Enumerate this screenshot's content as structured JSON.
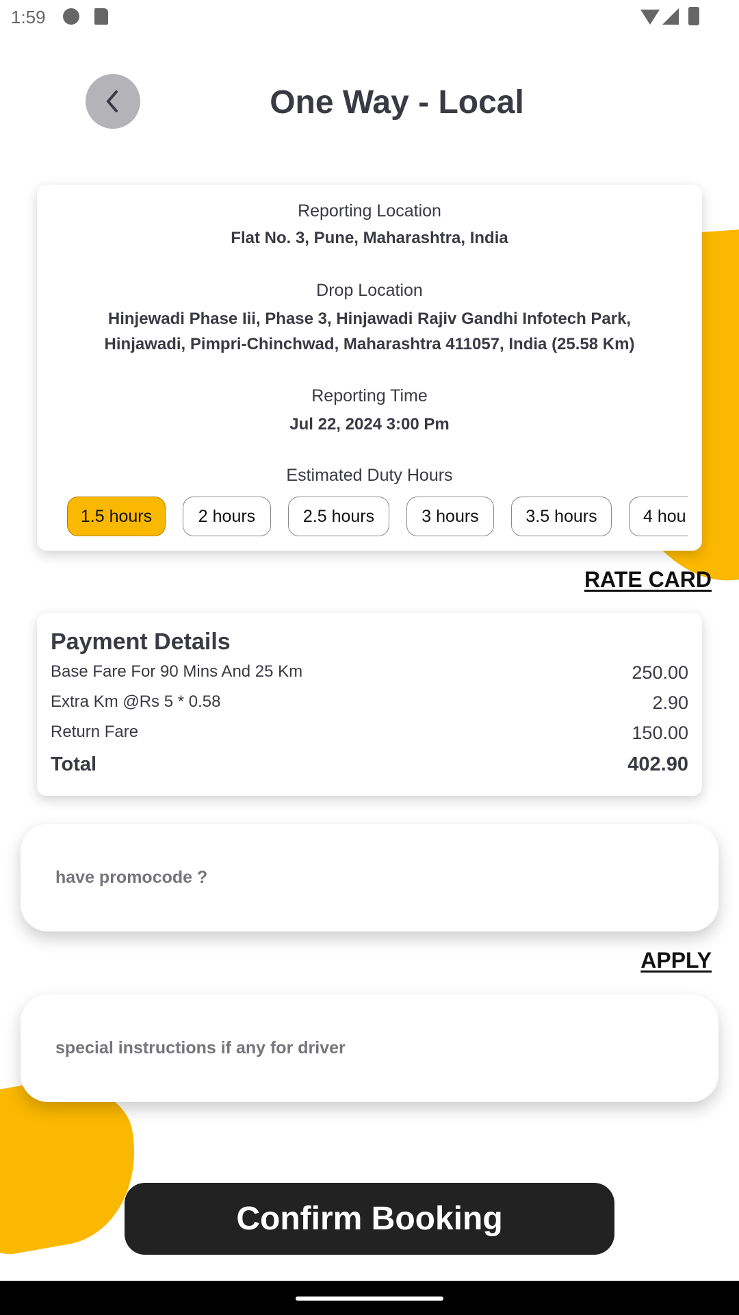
{
  "status_bar": {
    "time": "1:59",
    "icons": [
      "face-icon",
      "sd-card-icon",
      "wifi-icon",
      "signal-icon",
      "battery-icon"
    ]
  },
  "header": {
    "title": "One Way - Local",
    "back_icon": "chevron-left-icon"
  },
  "trip": {
    "reporting_location_label": "Reporting Location",
    "reporting_location": "Flat No. 3, Pune, Maharashtra, India",
    "drop_location_label": "Drop Location",
    "drop_location_line1": "Hinjewadi Phase Iii, Phase 3, Hinjawadi Rajiv Gandhi Infotech Park,",
    "drop_location_line2": "Hinjawadi, Pimpri-Chinchwad, Maharashtra 411057, India (25.58 Km)",
    "reporting_time_label": "Reporting Time",
    "reporting_time": "Jul 22, 2024 3:00 Pm",
    "duty_hours_label": "Estimated Duty Hours",
    "duty_hours": [
      "1.5 hours",
      "2 hours",
      "2.5 hours",
      "3 hours",
      "3.5 hours",
      "4 hou"
    ],
    "selected_duty_hours": "1.5 hours"
  },
  "rate_card_label": "RATE CARD",
  "payment": {
    "title": "Payment Details",
    "rows": [
      {
        "label": "Base Fare For 90 Mins And 25 Km",
        "amount": "250.00"
      },
      {
        "label": "Extra Km @Rs 5 * 0.58",
        "amount": "2.90"
      },
      {
        "label": "Return Fare",
        "amount": "150.00"
      }
    ],
    "total_label": "Total",
    "total": "402.90"
  },
  "promo": {
    "placeholder": "have promocode ?",
    "apply_label": "APPLY"
  },
  "instructions": {
    "placeholder": "special instructions if any for driver"
  },
  "confirm_label": "Confirm Booking",
  "colors": {
    "accent": "#fbb800",
    "button": "#222222",
    "text": "#3a3a44"
  }
}
